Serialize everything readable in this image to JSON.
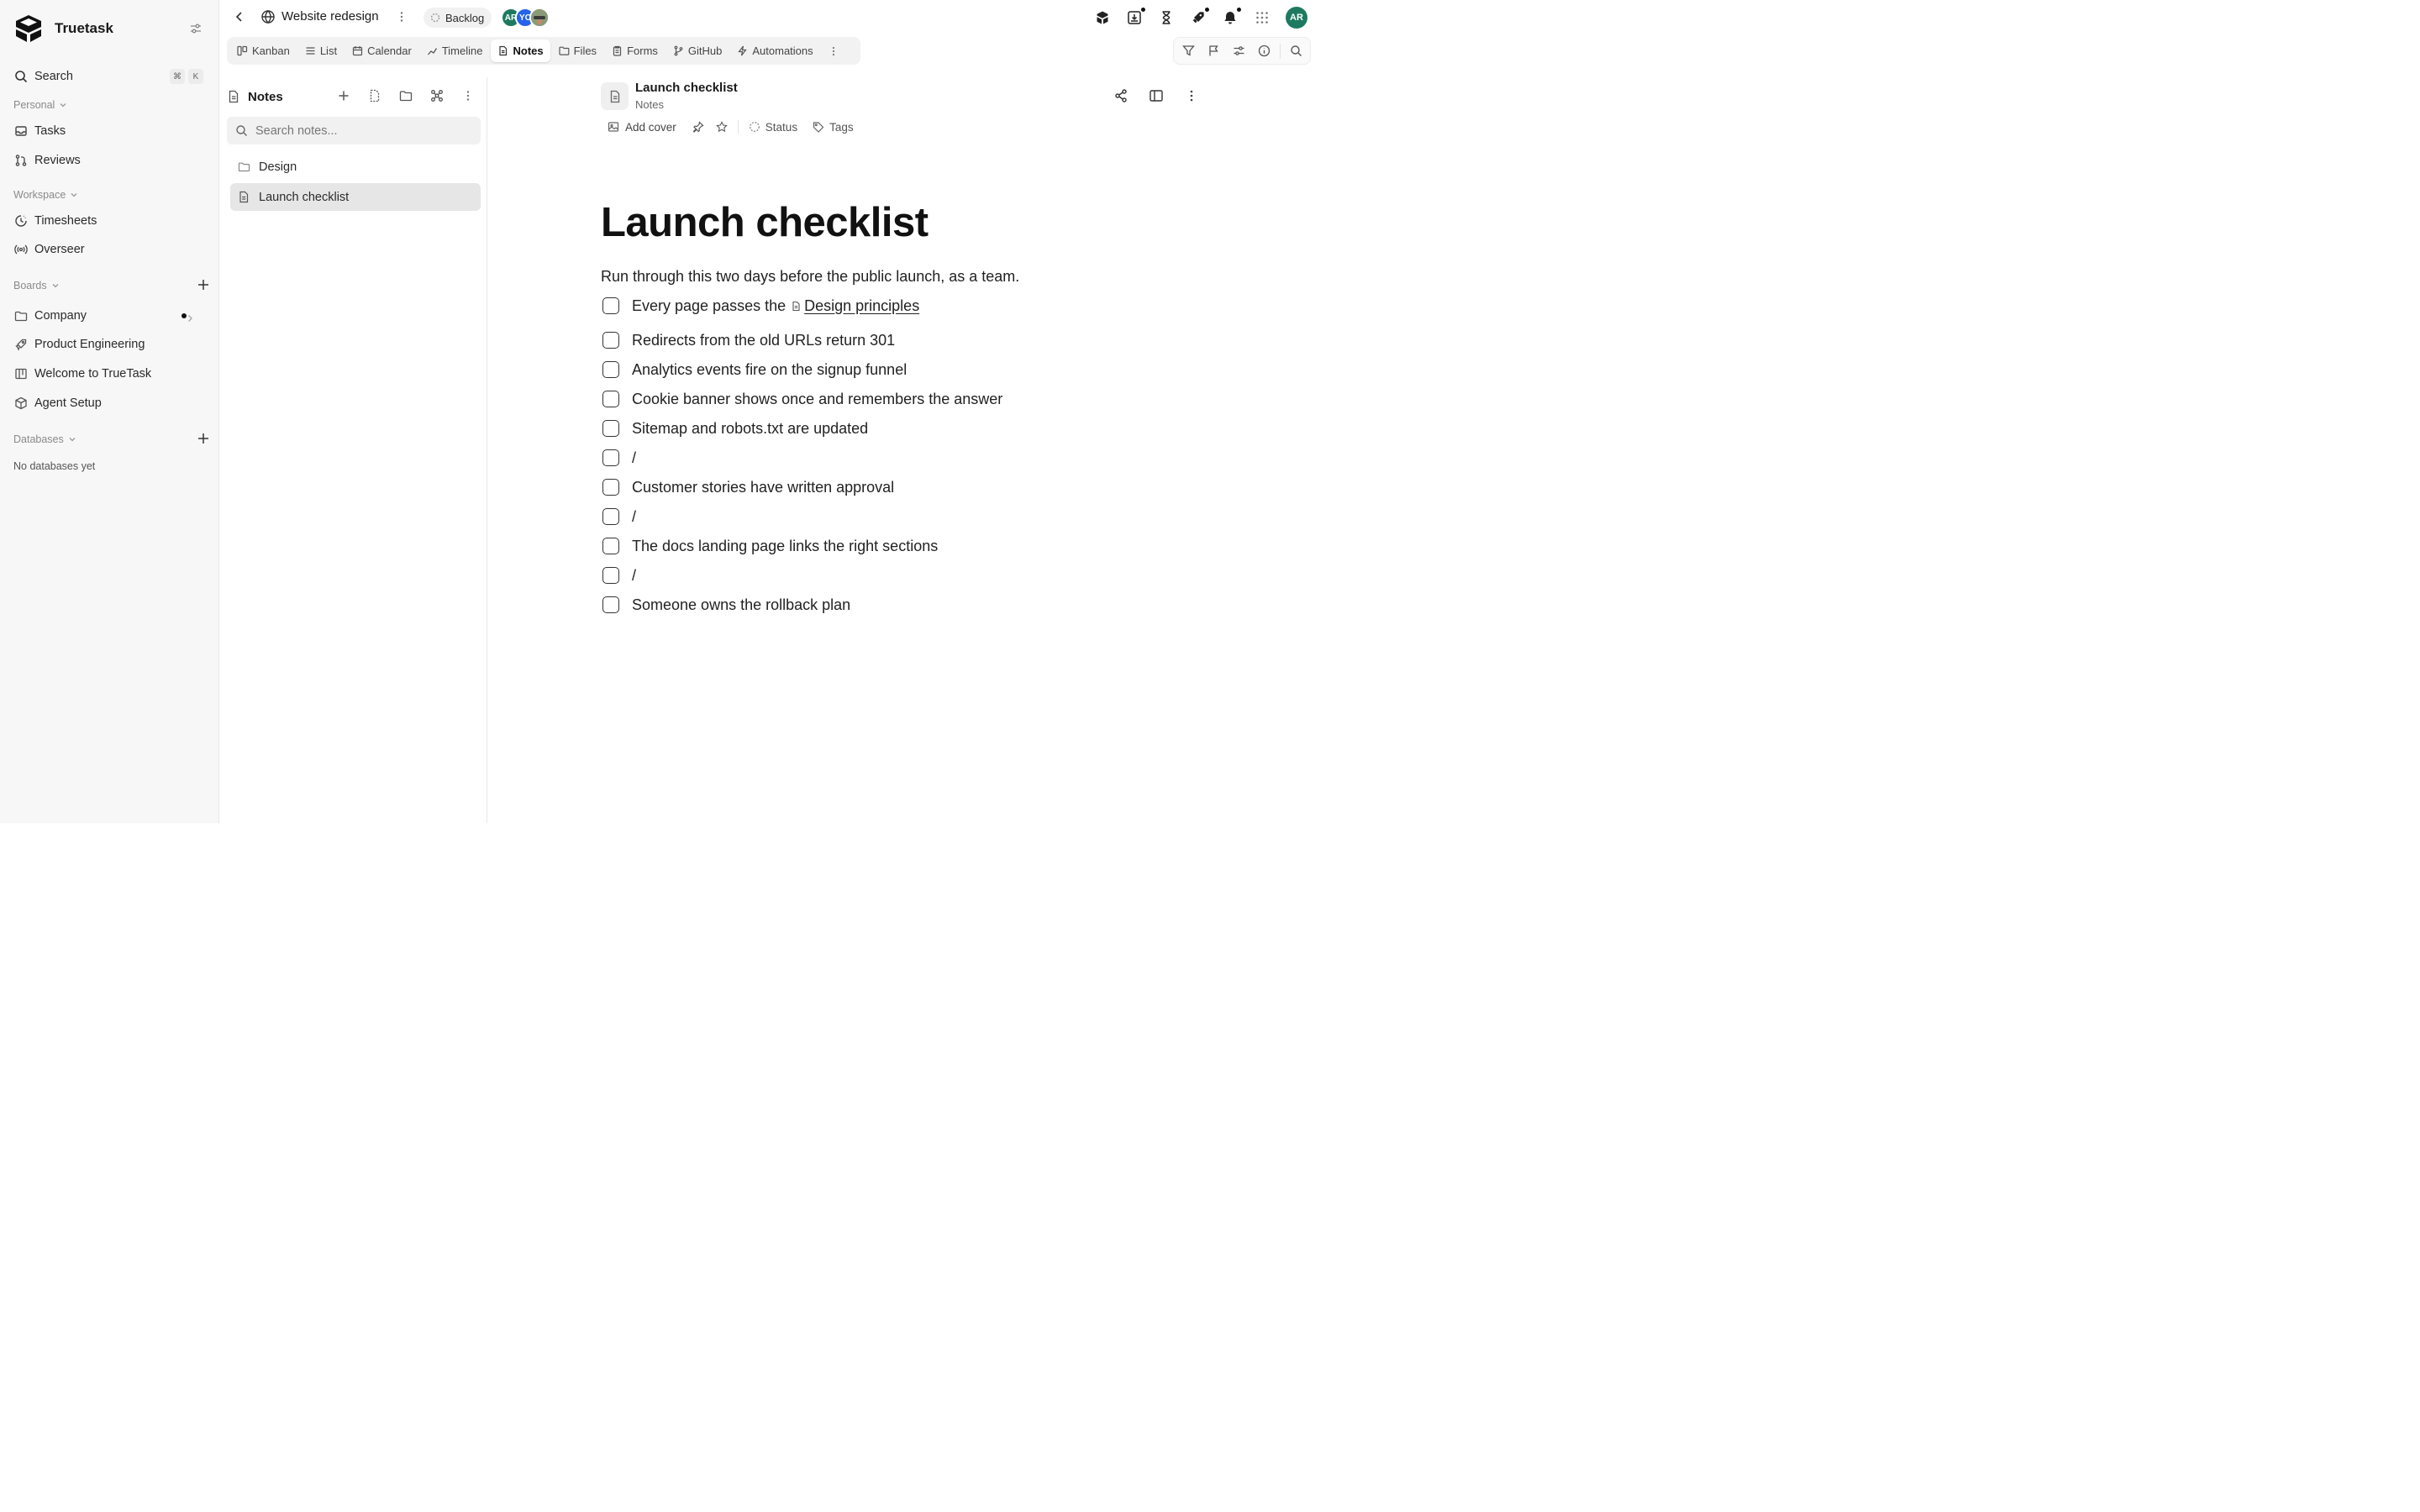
{
  "app": {
    "name": "Truetask"
  },
  "sidebar": {
    "search_label": "Search",
    "search_shortcut": [
      "⌘",
      "K"
    ],
    "personal_label": "Personal",
    "personal_items": [
      {
        "label": "Tasks",
        "icon": "inbox-icon"
      },
      {
        "label": "Reviews",
        "icon": "git-pull-icon"
      }
    ],
    "workspace_label": "Workspace",
    "workspace_items": [
      {
        "label": "Timesheets",
        "icon": "clock-icon"
      },
      {
        "label": "Overseer",
        "icon": "radio-icon"
      }
    ],
    "boards_label": "Boards",
    "boards_items": [
      {
        "label": "Company",
        "icon": "folder-icon"
      },
      {
        "label": "Product Engineering",
        "icon": "rocket-icon"
      },
      {
        "label": "Welcome to TrueTask",
        "icon": "kanban-icon"
      },
      {
        "label": "Agent Setup",
        "icon": "box-icon"
      }
    ],
    "databases_label": "Databases",
    "databases_empty": "No databases yet"
  },
  "topbar": {
    "project_title": "Website redesign",
    "status": "Backlog",
    "avatars": [
      {
        "initials": "AR",
        "color": "#1d7a60"
      },
      {
        "initials": "YC",
        "color": "#2563eb"
      },
      {
        "initials": "",
        "color": "#7a8a6a"
      }
    ],
    "user_initials": "AR"
  },
  "tabs": [
    {
      "label": "Kanban",
      "icon": "kanban-icon",
      "active": false
    },
    {
      "label": "List",
      "icon": "list-icon",
      "active": false
    },
    {
      "label": "Calendar",
      "icon": "calendar-icon",
      "active": false
    },
    {
      "label": "Timeline",
      "icon": "timeline-icon",
      "active": false
    },
    {
      "label": "Notes",
      "icon": "note-icon",
      "active": true
    },
    {
      "label": "Files",
      "icon": "folder-open-icon",
      "active": false
    },
    {
      "label": "Forms",
      "icon": "clipboard-icon",
      "active": false
    },
    {
      "label": "GitHub",
      "icon": "git-branch-icon",
      "active": false
    },
    {
      "label": "Automations",
      "icon": "bolt-icon",
      "active": false
    }
  ],
  "notes_panel": {
    "title": "Notes",
    "search_placeholder": "Search notes...",
    "items": [
      {
        "label": "Design",
        "type": "folder",
        "selected": false
      },
      {
        "label": "Launch checklist",
        "type": "note",
        "selected": true
      }
    ]
  },
  "document": {
    "name": "Launch checklist",
    "breadcrumb": "Notes",
    "add_cover_label": "Add cover",
    "status_label": "Status",
    "tags_label": "Tags",
    "heading": "Launch checklist",
    "intro": "Run through this two days before the public launch, as a team.",
    "checklist": [
      {
        "text": "Every page passes the ",
        "mention": "Design principles",
        "checked": false
      },
      {
        "text": "Redirects from the old URLs return 301",
        "checked": false
      },
      {
        "text": "Analytics events fire on the signup funnel",
        "checked": false
      },
      {
        "text": "Cookie banner shows once and remembers the answer",
        "checked": false
      },
      {
        "text": "Sitemap and robots.txt are updated",
        "checked": false
      },
      {
        "text": "/",
        "checked": false
      },
      {
        "text": "Customer stories have written approval",
        "checked": false
      },
      {
        "text": "/",
        "checked": false
      },
      {
        "text": "The docs landing page links the right sections",
        "checked": false
      },
      {
        "text": "/",
        "checked": false
      },
      {
        "text": "Someone owns the rollback plan",
        "checked": false
      }
    ]
  }
}
